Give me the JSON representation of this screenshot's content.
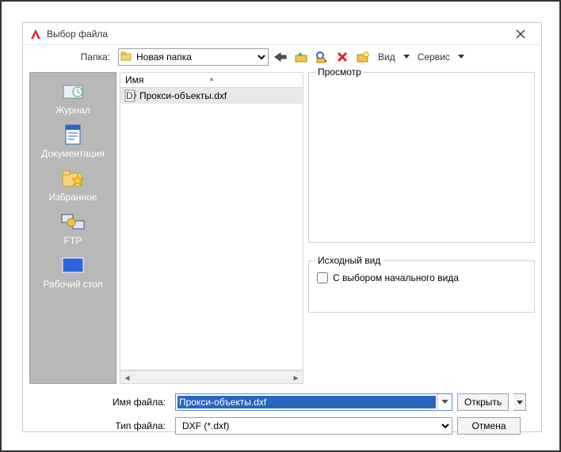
{
  "titlebar": {
    "title": "Выбор файла"
  },
  "toolbar": {
    "folder_label": "Папка:",
    "folder_value": "Новая папка",
    "view_label": "Вид",
    "tools_label": "Сервис"
  },
  "sidebar": {
    "items": [
      {
        "label": "Журнал"
      },
      {
        "label": "Документация"
      },
      {
        "label": "Избранное"
      },
      {
        "label": "FTP"
      },
      {
        "label": "Рабочий стол"
      }
    ]
  },
  "filelist": {
    "header": "Имя",
    "rows": [
      {
        "name": "Прокси-объекты.dxf"
      }
    ]
  },
  "preview": {
    "label": "Просмотр",
    "source_label": "Исходный вид",
    "checkbox_label": "С выбором начального вида"
  },
  "bottom": {
    "filename_label": "Имя файла:",
    "filename_value": "Прокси-объекты.dxf",
    "filetype_label": "Тип файла:",
    "filetype_value": "DXF (*.dxf)",
    "open_label": "Открыть",
    "cancel_label": "Отмена"
  }
}
